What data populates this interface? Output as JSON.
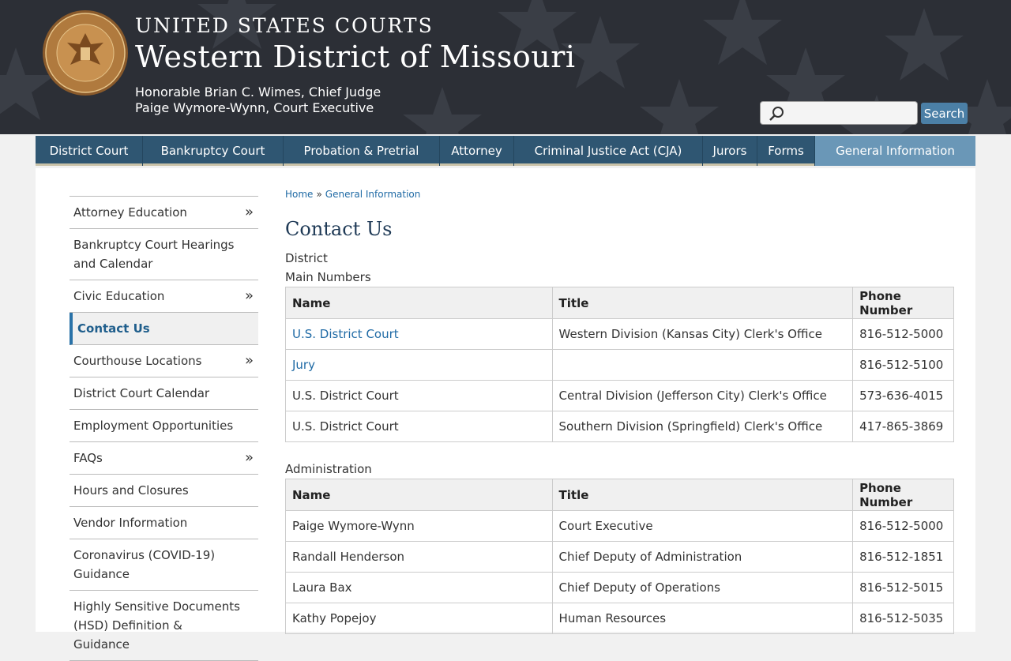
{
  "header": {
    "title_top": "UNITED STATES COURTS",
    "title_main": "Western District of Missouri",
    "judge": "Honorable Brian C. Wimes, Chief Judge",
    "executive": "Paige Wymore-Wynn, Court Executive",
    "search_placeholder": "",
    "search_button": "Search"
  },
  "nav": {
    "items": [
      {
        "label": "District Court"
      },
      {
        "label": "Bankruptcy Court"
      },
      {
        "label": "Probation & Pretrial"
      },
      {
        "label": "Attorney"
      },
      {
        "label": "Criminal Justice Act (CJA)"
      },
      {
        "label": "Jurors"
      },
      {
        "label": "Forms"
      },
      {
        "label": "General Information"
      }
    ],
    "active": "General Information"
  },
  "sidebar": {
    "items": [
      {
        "label": "Attorney Education",
        "chevron": "»"
      },
      {
        "label": "Bankruptcy Court Hearings and Calendar"
      },
      {
        "label": "Civic Education",
        "chevron": "»"
      },
      {
        "label": "Contact Us"
      },
      {
        "label": "Courthouse Locations",
        "chevron": "»"
      },
      {
        "label": "District Court Calendar"
      },
      {
        "label": "Employment Opportunities"
      },
      {
        "label": "FAQs",
        "chevron": "»"
      },
      {
        "label": "Hours and Closures"
      },
      {
        "label": "Vendor Information"
      },
      {
        "label": "Coronavirus (COVID-19) Guidance"
      },
      {
        "label": "Highly Sensitive Documents (HSD) Definition & Guidance"
      }
    ],
    "active": "Contact Us"
  },
  "breadcrumb": {
    "home": "Home",
    "separator": "»",
    "current": "General Information"
  },
  "page": {
    "title": "Contact Us",
    "section1": "District",
    "section1_sub": "Main Numbers",
    "section2": "Administration"
  },
  "table_headers": {
    "name": "Name",
    "title": "Title",
    "phone": "Phone Number"
  },
  "main_numbers": [
    {
      "name": "U.S. District Court",
      "title": "Western Division (Kansas City) Clerk's Office",
      "phone": "816-512-5000",
      "link": true
    },
    {
      "name": "Jury",
      "title": "",
      "phone": "816-512-5100",
      "link": true
    },
    {
      "name": "U.S. District Court",
      "title": "Central Division (Jefferson City) Clerk's Office",
      "phone": "573-636-4015",
      "link": false
    },
    {
      "name": "U.S. District Court",
      "title": "Southern Division (Springfield) Clerk's Office",
      "phone": "417-865-3869",
      "link": false
    }
  ],
  "administration": [
    {
      "name": "Paige Wymore-Wynn",
      "title": "Court Executive",
      "phone": "816-512-5000"
    },
    {
      "name": "Randall Henderson",
      "title": "Chief Deputy of Administration",
      "phone": "816-512-1851"
    },
    {
      "name": "Laura Bax",
      "title": "Chief Deputy of Operations",
      "phone": "816-512-5015"
    },
    {
      "name": "Kathy Popejoy",
      "title": "Human Resources",
      "phone": "816-512-5035"
    }
  ],
  "colors": {
    "header_bg": "#2c2f36",
    "nav_bg": "#2f5672",
    "nav_active": "#6a97b7",
    "link": "#1f6aa5",
    "title": "#1f3a56"
  },
  "icons": {
    "seal": "court-seal-icon",
    "search": "magnifier-icon",
    "chevron": "double-chevron-right-icon"
  }
}
